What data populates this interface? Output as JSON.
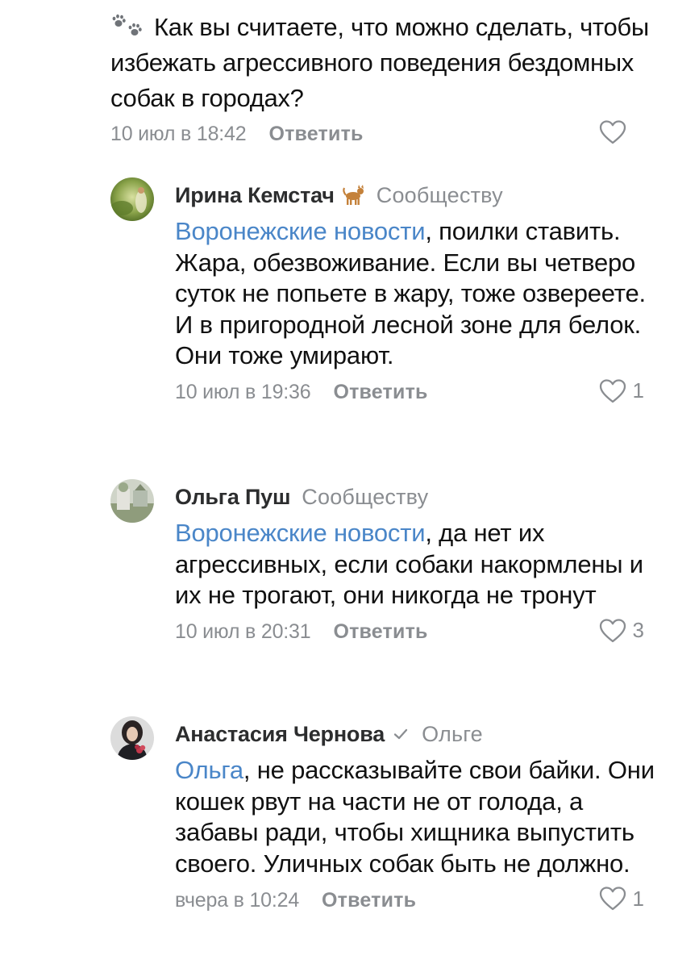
{
  "top_comment": {
    "icon": "paw-prints-icon",
    "text": "Как вы считаете, что можно сделать, чтобы избежать агрессивного поведения бездомных собак в городах?",
    "date": "10 июл в 18:42",
    "reply_label": "Ответить",
    "likes": ""
  },
  "replies": [
    {
      "author": "Ирина Кемстач",
      "author_badge": "dog-emoji-icon",
      "target": "Сообществу",
      "mention": "Воронежские новости",
      "text": ", поилки ставить. Жара, обезвоживание. Если вы четверо суток не попьете в жару, тоже озвереете. И в пригородной лесной зоне для белок. Они тоже умирают.",
      "date": "10 июл в 19:36",
      "reply_label": "Ответить",
      "likes": "1"
    },
    {
      "author": "Ольга Пуш",
      "target": "Сообществу",
      "mention": "Воронежские новости",
      "text": ",  да нет их агрессивных, если собаки накормлены и их не трогают, они никогда не тронут",
      "date": "10 июл в 20:31",
      "reply_label": "Ответить",
      "likes": "3"
    },
    {
      "author": "Анастасия Чернова",
      "author_badge": "verified-check-icon",
      "target": "Ольге",
      "mention": "Ольга",
      "text": ", не рассказывайте свои байки. Они кошек рвут на части не от голода, а забавы ради, чтобы хищника выпустить своего. Уличных собак быть не должно.",
      "date": "вчера в 10:24",
      "reply_label": "Ответить",
      "likes": "1"
    }
  ],
  "colors": {
    "mention": "#4a86c8",
    "meta": "#8a8d91",
    "text": "#111111"
  }
}
